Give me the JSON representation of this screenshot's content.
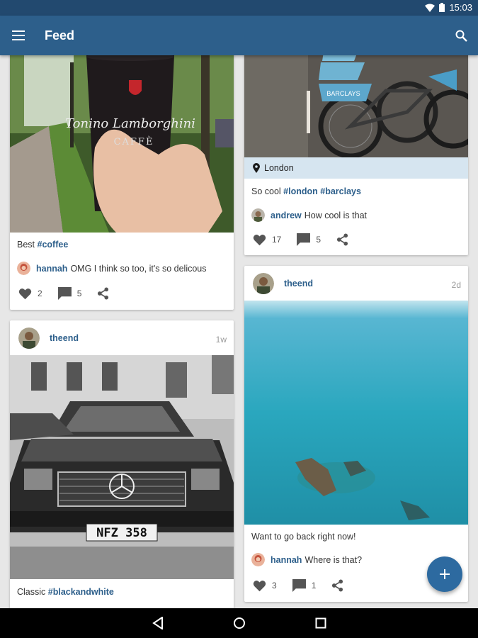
{
  "status_bar": {
    "time": "15:03"
  },
  "app_bar": {
    "title": "Feed"
  },
  "colors": {
    "primary": "#2d5f8b",
    "status": "#22496f",
    "accent": "#2d6aa0",
    "location_bg": "#d6e5f0"
  },
  "posts": [
    {
      "caption_prefix": "Best ",
      "caption_tag": "#coffee",
      "comment_user": "hannah",
      "comment_text": "OMG I think so too, it's so delicous",
      "likes": "2",
      "comments": "5"
    },
    {
      "location": "London",
      "caption_prefix": "So cool ",
      "caption_tag": "#london #barclays",
      "comment_user": "andrew",
      "comment_text": "How cool is that",
      "likes": "17",
      "comments": "5"
    },
    {
      "user": "theend",
      "time": "1w",
      "caption_prefix": "Classic ",
      "caption_tag": "#blackandwhite",
      "plate_text": "NFZ 358"
    },
    {
      "user": "theend",
      "time": "2d",
      "caption_prefix": "Want to go back right now!",
      "comment_user": "hannah",
      "comment_text": "Where is that?",
      "likes": "3",
      "comments": "1"
    }
  ],
  "photo_text": {
    "cup_brand": "Tonino Lamborghini",
    "cup_sub": "CAFFÈ",
    "bike_brand": "BARCLAYS"
  },
  "icons": {
    "menu": "menu-icon",
    "search": "search-icon",
    "like": "heart-icon",
    "comment": "comment-icon",
    "share": "share-icon",
    "location": "location-pin-icon",
    "fab": "plus-icon",
    "nav_back": "back-icon",
    "nav_home": "home-icon",
    "nav_recent": "recent-apps-icon"
  }
}
